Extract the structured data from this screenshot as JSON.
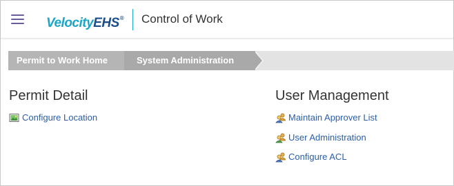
{
  "header": {
    "logo_part_a": "Velocity",
    "logo_part_b": "EHS",
    "logo_mark": "®",
    "app_title": "Control of Work",
    "menu_icon": "hamburger-menu-icon"
  },
  "breadcrumb": [
    {
      "label": "Permit to Work Home"
    },
    {
      "label": "System Administration"
    }
  ],
  "sections": {
    "permit_detail": {
      "title": "Permit Detail",
      "links": [
        {
          "label": "Configure Location",
          "icon": "location-map-icon"
        }
      ]
    },
    "user_management": {
      "title": "User Management",
      "links": [
        {
          "label": "Maintain Approver List",
          "icon": "users-icon"
        },
        {
          "label": "User Administration",
          "icon": "users-icon"
        },
        {
          "label": "Configure ACL",
          "icon": "users-icon"
        }
      ]
    }
  },
  "colors": {
    "link": "#2a5ea7",
    "brand_light": "#1aa6c7",
    "brand_dark": "#1d4e8c",
    "menu": "#6a5c9a"
  }
}
